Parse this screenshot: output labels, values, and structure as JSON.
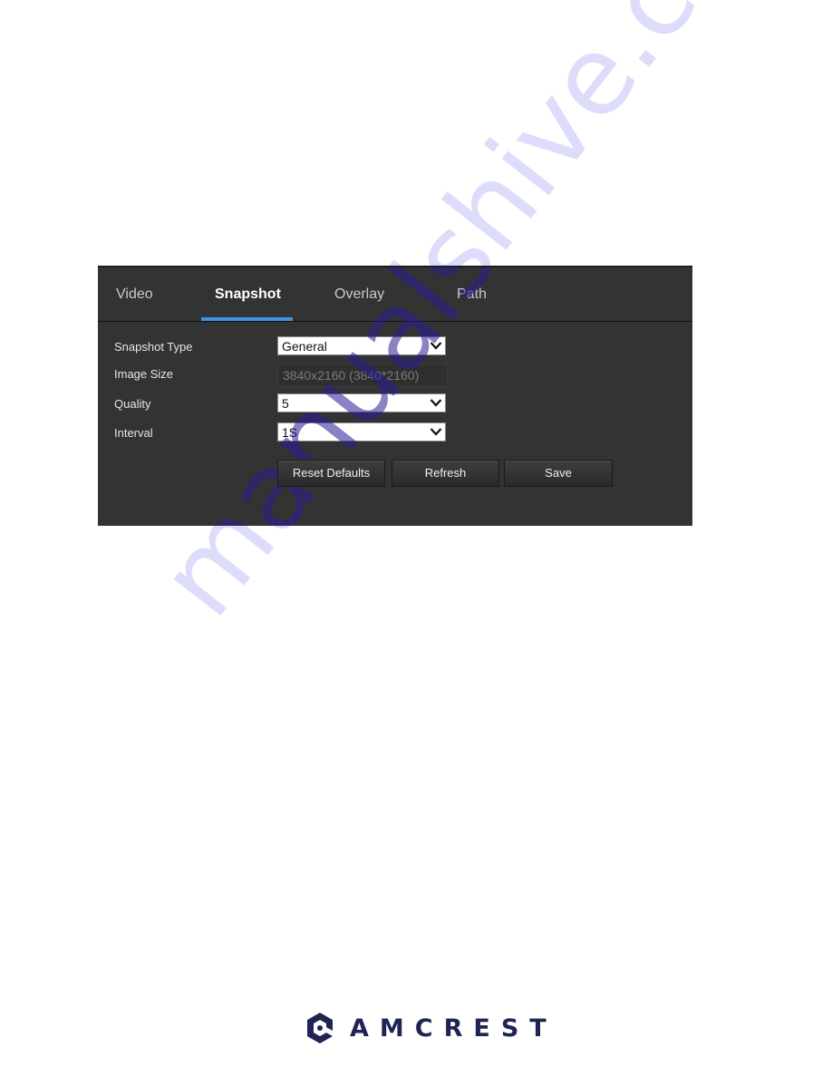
{
  "tabs": [
    {
      "label": "Video",
      "active": false
    },
    {
      "label": "Snapshot",
      "active": true
    },
    {
      "label": "Overlay",
      "active": false
    },
    {
      "label": "Path",
      "active": false
    }
  ],
  "form": {
    "snapshot_type": {
      "label": "Snapshot Type",
      "value": "General"
    },
    "image_size": {
      "label": "Image Size",
      "value": "3840x2160 (3840*2160)"
    },
    "quality": {
      "label": "Quality",
      "value": "5"
    },
    "interval": {
      "label": "Interval",
      "value": "1S"
    }
  },
  "buttons": {
    "reset_defaults": "Reset Defaults",
    "refresh": "Refresh",
    "save": "Save"
  },
  "brand": {
    "name": "AMCREST",
    "color": "#1f2455",
    "accent": "#3d95e0"
  },
  "watermark": "manualshive.com",
  "colors": {
    "panel_bg": "#333333",
    "active_tab_underline": "#3d95e0"
  }
}
